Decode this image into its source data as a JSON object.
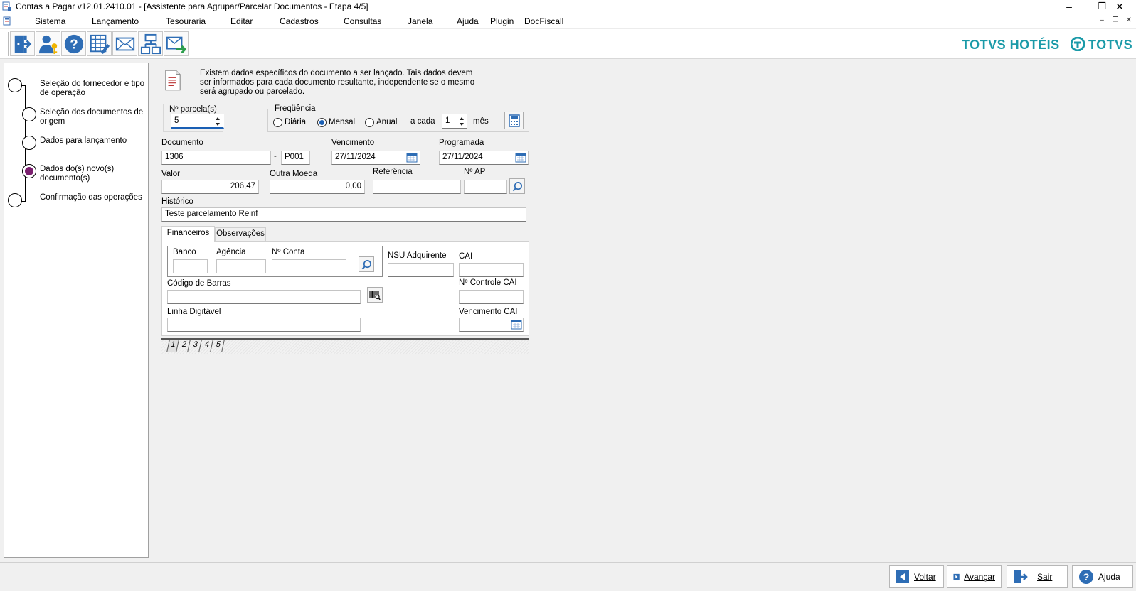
{
  "window": {
    "title": "Contas a Pagar v12.01.2410.01 - [Assistente para Agrupar/Parcelar Documentos - Etapa 4/5]",
    "minimize": "–",
    "restore": "❐",
    "close": "✕"
  },
  "menu": {
    "items": [
      "Sistema",
      "Lançamento",
      "Tesouraria",
      "Editar",
      "Cadastros",
      "Consultas",
      "Janela",
      "Ajuda",
      "Plugin",
      "DocFiscall"
    ],
    "mdi_minimize": "–",
    "mdi_restore": "❐",
    "mdi_close": "✕"
  },
  "brand": {
    "left": "TOTVS HOTÉIS",
    "right": "TOTVS"
  },
  "wizard": {
    "steps": [
      {
        "label": "Seleção do fornecedor e tipo de operação"
      },
      {
        "label": "Seleção dos documentos de origem"
      },
      {
        "label": "Dados para lançamento"
      },
      {
        "label": "Dados do(s) novo(s) documento(s)"
      },
      {
        "label": "Confirmação das operações"
      }
    ],
    "current_step": 4
  },
  "info_text": "Existem dados específicos do documento a ser lançado. Tais dados devem ser informados para cada documento resultante, independente se o mesmo será agrupado ou parcelado.",
  "form": {
    "parcelas": {
      "label": "Nº parcela(s)",
      "value": "5"
    },
    "frequencia": {
      "label": "Freqüência",
      "options": [
        "Diária",
        "Mensal",
        "Anual"
      ],
      "selected": "Mensal",
      "a_cada_label": "a cada",
      "a_cada_value": "1",
      "unit": "mês"
    },
    "documento": {
      "label": "Documento",
      "value": "1306",
      "separator": "-",
      "suffix": "P001"
    },
    "vencimento": {
      "label": "Vencimento",
      "value": "27/11/2024"
    },
    "programada": {
      "label": "Programada",
      "value": "27/11/2024"
    },
    "valor": {
      "label": "Valor",
      "value": "206,47"
    },
    "outra_moeda": {
      "label": "Outra Moeda",
      "value": "0,00"
    },
    "referencia": {
      "label": "Referência",
      "value": ""
    },
    "n_ap": {
      "label": "Nº AP",
      "value": ""
    },
    "historico": {
      "label": "Histórico",
      "value": "Teste parcelamento Reinf"
    }
  },
  "tabs": {
    "items": [
      "Financeiros",
      "Observações"
    ],
    "active": "Financeiros"
  },
  "financeiros": {
    "banco": {
      "label": "Banco",
      "value": ""
    },
    "agencia": {
      "label": "Agência",
      "value": ""
    },
    "conta": {
      "label": "Nº Conta",
      "value": ""
    },
    "nsu": {
      "label": "NSU Adquirente",
      "value": ""
    },
    "cai": {
      "label": "CAI",
      "value": ""
    },
    "codigo_barras": {
      "label": "Código de Barras",
      "value": ""
    },
    "controle_cai": {
      "label": "Nº Controle CAI",
      "value": ""
    },
    "linha_digitavel": {
      "label": "Linha Digitável",
      "value": ""
    },
    "vencimento_cai": {
      "label": "Vencimento CAI",
      "value": ""
    }
  },
  "page_tabs": [
    "1",
    "2",
    "3",
    "4",
    "5"
  ],
  "buttons": {
    "voltar": "Voltar",
    "avancar": "Avançar",
    "sair": "Sair",
    "ajuda": "Ajuda"
  }
}
